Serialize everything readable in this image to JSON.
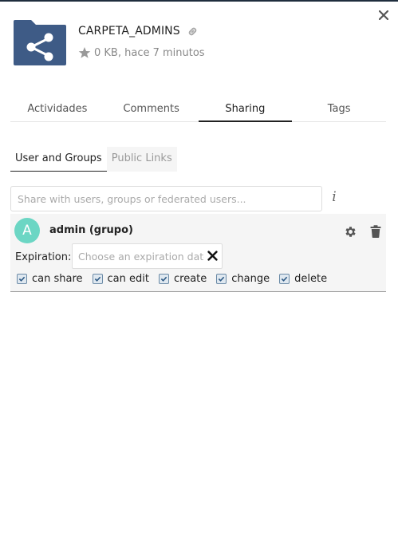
{
  "item": {
    "name": "CARPETA_ADMINS",
    "meta": "0 KB, hace 7 minutos"
  },
  "tabs": [
    {
      "label": "Actividades",
      "active": false
    },
    {
      "label": "Comments",
      "active": false
    },
    {
      "label": "Sharing",
      "active": true
    },
    {
      "label": "Tags",
      "active": false
    }
  ],
  "subtabs": [
    {
      "label": "User and Groups",
      "active": true
    },
    {
      "label": "Public Links",
      "active": false
    }
  ],
  "share": {
    "placeholder": "Share with users, groups or federated users...",
    "info_glyph": "i"
  },
  "share_entry": {
    "avatar_letter": "A",
    "name": "admin (grupo)",
    "expiration_label": "Expiration:",
    "expiration_placeholder": "Choose an expiration date",
    "permissions": [
      {
        "label": "can share",
        "checked": true
      },
      {
        "label": "can edit",
        "checked": true
      },
      {
        "label": "create",
        "checked": true
      },
      {
        "label": "change",
        "checked": true
      },
      {
        "label": "delete",
        "checked": true
      }
    ]
  },
  "colors": {
    "folder": "#3e5b86",
    "avatar": "#6cd6c4"
  },
  "icons": [
    "close-icon",
    "share-icon",
    "link-icon",
    "star-icon",
    "info-icon",
    "gear-icon",
    "trash-icon",
    "clear-icon",
    "check-icon"
  ]
}
